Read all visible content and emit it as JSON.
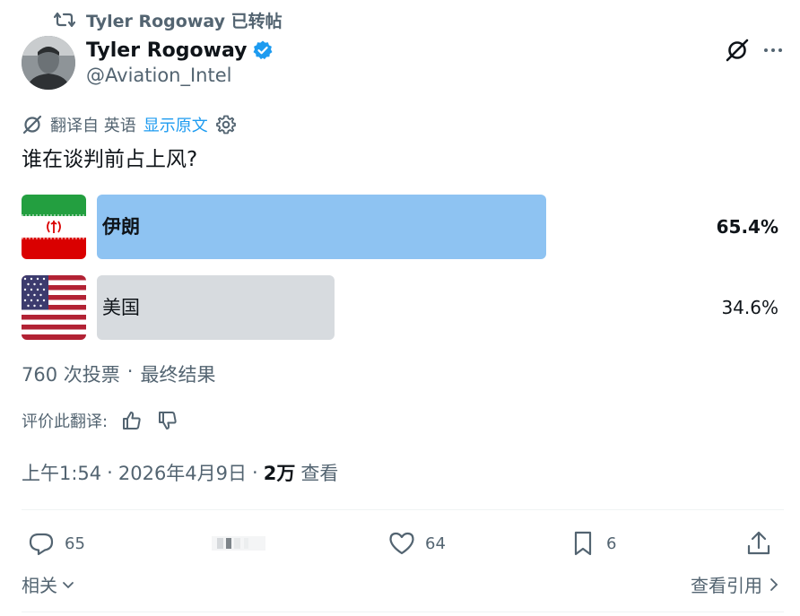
{
  "retweet": {
    "icon": "retweet-icon",
    "text": "Tyler Rogoway 已转帖"
  },
  "author": {
    "name": "Tyler Rogoway",
    "handle": "@Aviation_Intel",
    "verified_icon": "verified-badge-icon"
  },
  "translation": {
    "label": "翻译自 英语",
    "show_original": "显示原文"
  },
  "question": "谁在谈判前占上风?",
  "poll": {
    "options": [
      {
        "label": "伊朗",
        "percent_text": "65.4%",
        "percent": 65.4,
        "flag": "iran-flag",
        "winner": true
      },
      {
        "label": "美国",
        "percent_text": "34.6%",
        "percent": 34.6,
        "flag": "us-flag",
        "winner": false
      }
    ],
    "votes": "760 次投票",
    "status": "最终结果"
  },
  "rate_translation": "评价此翻译:",
  "meta": {
    "time": "上午1:54",
    "date": "2026年4月9日",
    "views_count": "2万",
    "views_label": "查看"
  },
  "actions": {
    "replies": "65",
    "likes": "64",
    "bookmarks": "6"
  },
  "footer": {
    "related": "相关",
    "view_quotes": "查看引用"
  },
  "colors": {
    "accent": "#1d9bf0",
    "winner_bar": "#8ec3f2",
    "loser_bar": "#d7dbdf",
    "muted": "#536471"
  }
}
